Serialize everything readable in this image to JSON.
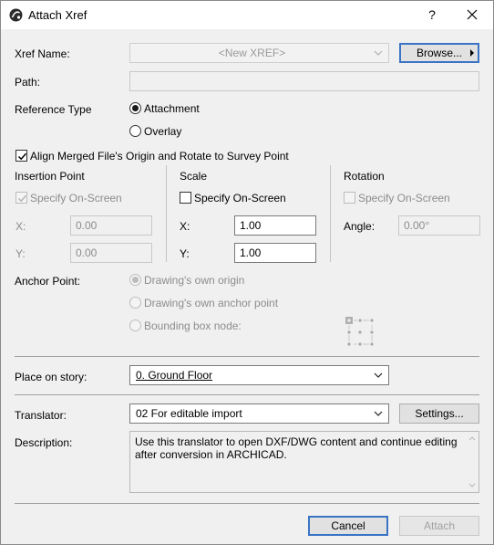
{
  "window": {
    "title": "Attach Xref",
    "help_label": "?",
    "app_icon": "archicad-logo-icon",
    "close_icon": "close-icon"
  },
  "xref": {
    "name_label": "Xref Name:",
    "name_value": "<New XREF>",
    "browse_label": "Browse...",
    "path_label": "Path:",
    "path_value": ""
  },
  "reference_type": {
    "label": "Reference Type",
    "options": [
      "Attachment",
      "Overlay"
    ],
    "selected": "Attachment"
  },
  "align": {
    "label": "Align Merged File's Origin and Rotate to Survey Point",
    "checked": true
  },
  "insertion": {
    "title": "Insertion Point",
    "specify_label": "Specify On-Screen",
    "specify_checked": true,
    "specify_enabled": false,
    "x_label": "X:",
    "x_value": "0.00",
    "y_label": "Y:",
    "y_value": "0.00"
  },
  "scale": {
    "title": "Scale",
    "specify_label": "Specify On-Screen",
    "specify_checked": false,
    "x_label": "X:",
    "x_value": "1.00",
    "y_label": "Y:",
    "y_value": "1.00"
  },
  "rotation": {
    "title": "Rotation",
    "specify_label": "Specify On-Screen",
    "specify_checked": false,
    "specify_enabled": false,
    "angle_label": "Angle:",
    "angle_value": "0.00°"
  },
  "anchor": {
    "label": "Anchor Point:",
    "options": [
      "Drawing's own origin",
      "Drawing's own anchor point",
      "Bounding box node:"
    ],
    "selected": "Drawing's own origin",
    "enabled": false,
    "node_icon": "bounding-box-nodes-icon"
  },
  "story": {
    "label": "Place on story:",
    "value": "0. Ground Floor"
  },
  "translator": {
    "label": "Translator:",
    "value": "02 For editable import",
    "settings_label": "Settings...",
    "description_label": "Description:",
    "description": "Use this translator to open DXF/DWG content and continue editing after conversion in ARCHICAD."
  },
  "footer": {
    "cancel_label": "Cancel",
    "attach_label": "Attach"
  },
  "colors": {
    "dialog_bg": "#f0f0f0",
    "default_button_border": "#3b74c4",
    "disabled_text": "#8c8c8c"
  }
}
